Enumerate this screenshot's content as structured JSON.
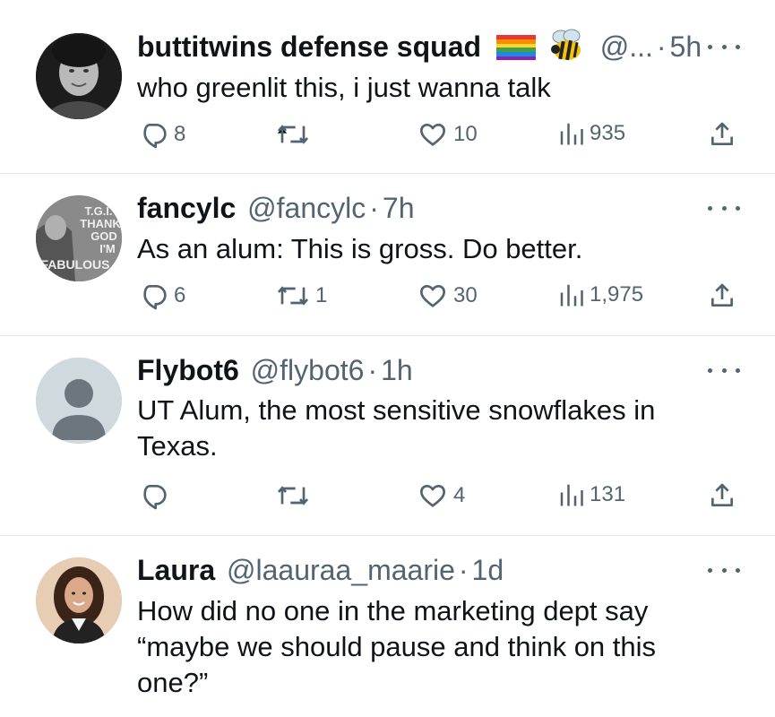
{
  "tweets": [
    {
      "name": "buttitwins defense squad",
      "emoji": [
        "rainbow-flag-icon",
        "bee-icon"
      ],
      "handle": "@...",
      "dot": "·",
      "time": "5h",
      "text": "who greenlit this, i just wanna talk",
      "replies": "8",
      "retweets": "",
      "likes": "10",
      "views": "935"
    },
    {
      "name": "fancylc",
      "handle": "@fancylc",
      "dot": "·",
      "time": "7h",
      "avatar_text": [
        "T.G.I.",
        "THANK",
        "GOD",
        "I'M",
        "FABULOUS"
      ],
      "text": "As an alum: This is gross. Do better.",
      "replies": "6",
      "retweets": "1",
      "likes": "30",
      "views": "1,975"
    },
    {
      "name": "Flybot6",
      "handle": "@flybot6",
      "dot": "·",
      "time": "1h",
      "text": "UT Alum, the most sensitive snowflakes in Texas.",
      "replies": "",
      "retweets": "",
      "likes": "4",
      "views": "131"
    },
    {
      "name": "Laura",
      "handle": "@laauraa_maarie",
      "dot": "·",
      "time": "1d",
      "text": "How did no one in the marketing dept say “maybe we should pause and think on this one?”"
    }
  ],
  "colors": {
    "text": "#0f1419",
    "secondary": "#536471",
    "divider": "#e4e7ea",
    "default_avatar_bg": "#cfd9de"
  }
}
